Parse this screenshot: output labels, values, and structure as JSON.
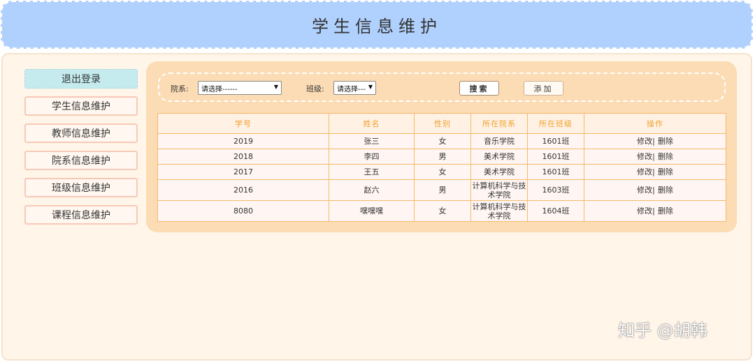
{
  "header": {
    "title": "学生信息维护"
  },
  "sidebar": {
    "items": [
      {
        "label": "退出登录"
      },
      {
        "label": "学生信息维护"
      },
      {
        "label": "教师信息维护"
      },
      {
        "label": "院系信息维护"
      },
      {
        "label": "班级信息维护"
      },
      {
        "label": "课程信息维护"
      }
    ]
  },
  "toolbar": {
    "dept_label": "院系:",
    "dept_select_value": "请选择------",
    "class_label": "班级:",
    "class_select_value": "请选择---",
    "search_label": "搜索",
    "add_label": "添加"
  },
  "table": {
    "headers": [
      "学号",
      "姓名",
      "性别",
      "所在院系",
      "所在班级",
      "操作"
    ],
    "rows": [
      {
        "id": "2019",
        "name": "张三",
        "gender": "女",
        "dept": "音乐学院",
        "class": "1601班",
        "edit": "修改|",
        "delete": "删除"
      },
      {
        "id": "2018",
        "name": "李四",
        "gender": "男",
        "dept": "美术学院",
        "class": "1601班",
        "edit": "修改|",
        "delete": "删除"
      },
      {
        "id": "2017",
        "name": "王五",
        "gender": "女",
        "dept": "美术学院",
        "class": "1601班",
        "edit": "修改|",
        "delete": "删除"
      },
      {
        "id": "2016",
        "name": "赵六",
        "gender": "男",
        "dept": "计算机科学与技术学院",
        "class": "1603班",
        "edit": "修改|",
        "delete": "删除"
      },
      {
        "id": "8080",
        "name": "嘿嘿嘿",
        "gender": "女",
        "dept": "计算机科学与技术学院",
        "class": "1604班",
        "edit": "修改|",
        "delete": "删除"
      }
    ]
  },
  "watermark": "知乎 @胡韩"
}
